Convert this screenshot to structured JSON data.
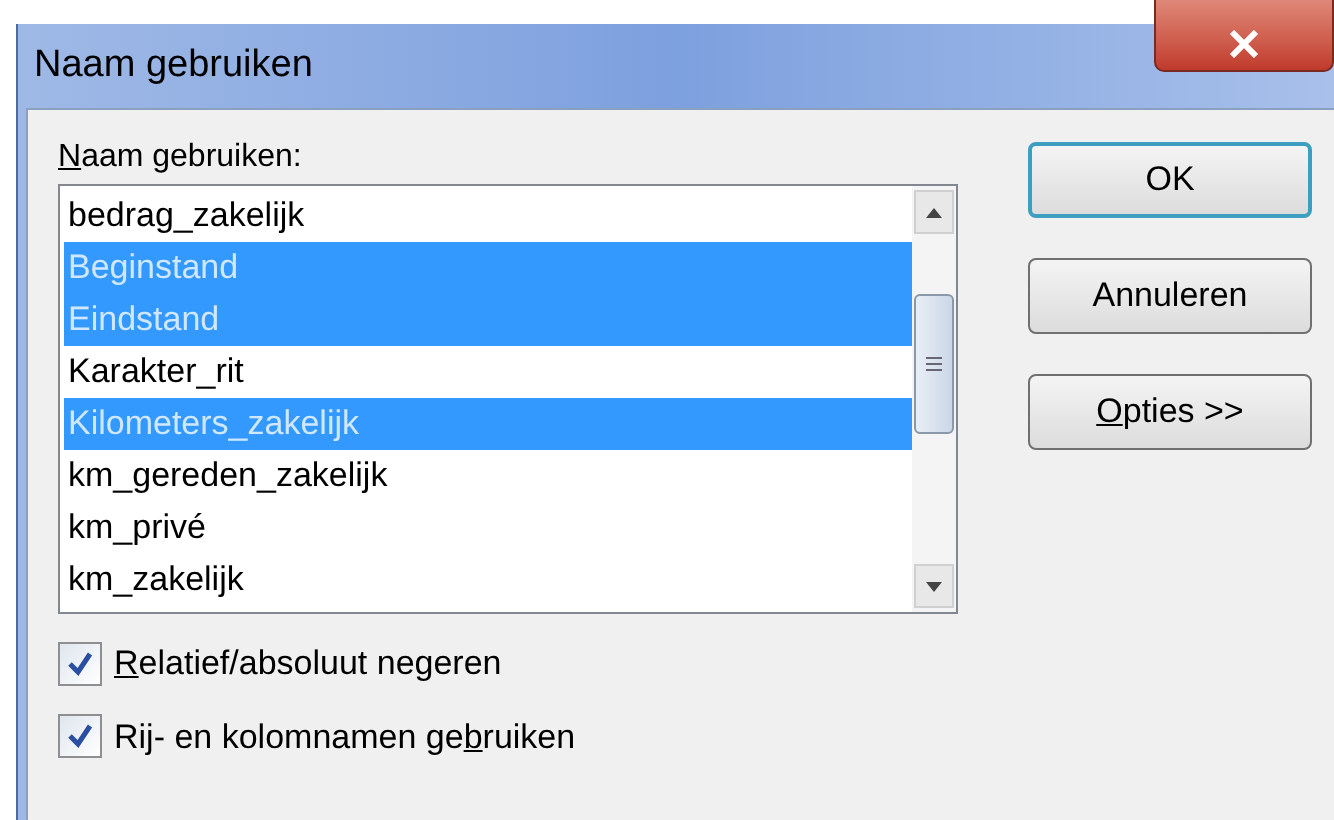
{
  "window": {
    "title": "Naam gebruiken"
  },
  "list_label": {
    "key": "N",
    "after": "aam gebruiken:"
  },
  "items": [
    {
      "label": "bedrag_zakelijk",
      "selected": false
    },
    {
      "label": "Beginstand",
      "selected": true
    },
    {
      "label": "Eindstand",
      "selected": true
    },
    {
      "label": "Karakter_rit",
      "selected": false
    },
    {
      "label": "Kilometers_zakelijk",
      "selected": true
    },
    {
      "label": "km_gereden_zakelijk",
      "selected": false
    },
    {
      "label": "km_privé",
      "selected": false
    },
    {
      "label": "km_zakelijk",
      "selected": false
    }
  ],
  "checkboxes": [
    {
      "key": "R",
      "after": "elatief/absoluut negeren",
      "checked": true
    },
    {
      "before": "Rij- en kolomnamen ge",
      "key": "b",
      "after": "ruiken",
      "checked": true
    }
  ],
  "buttons": [
    {
      "before": "OK",
      "default": true
    },
    {
      "before": "Annuleren",
      "default": false
    },
    {
      "key": "O",
      "after": "pties >>",
      "default": false
    }
  ]
}
